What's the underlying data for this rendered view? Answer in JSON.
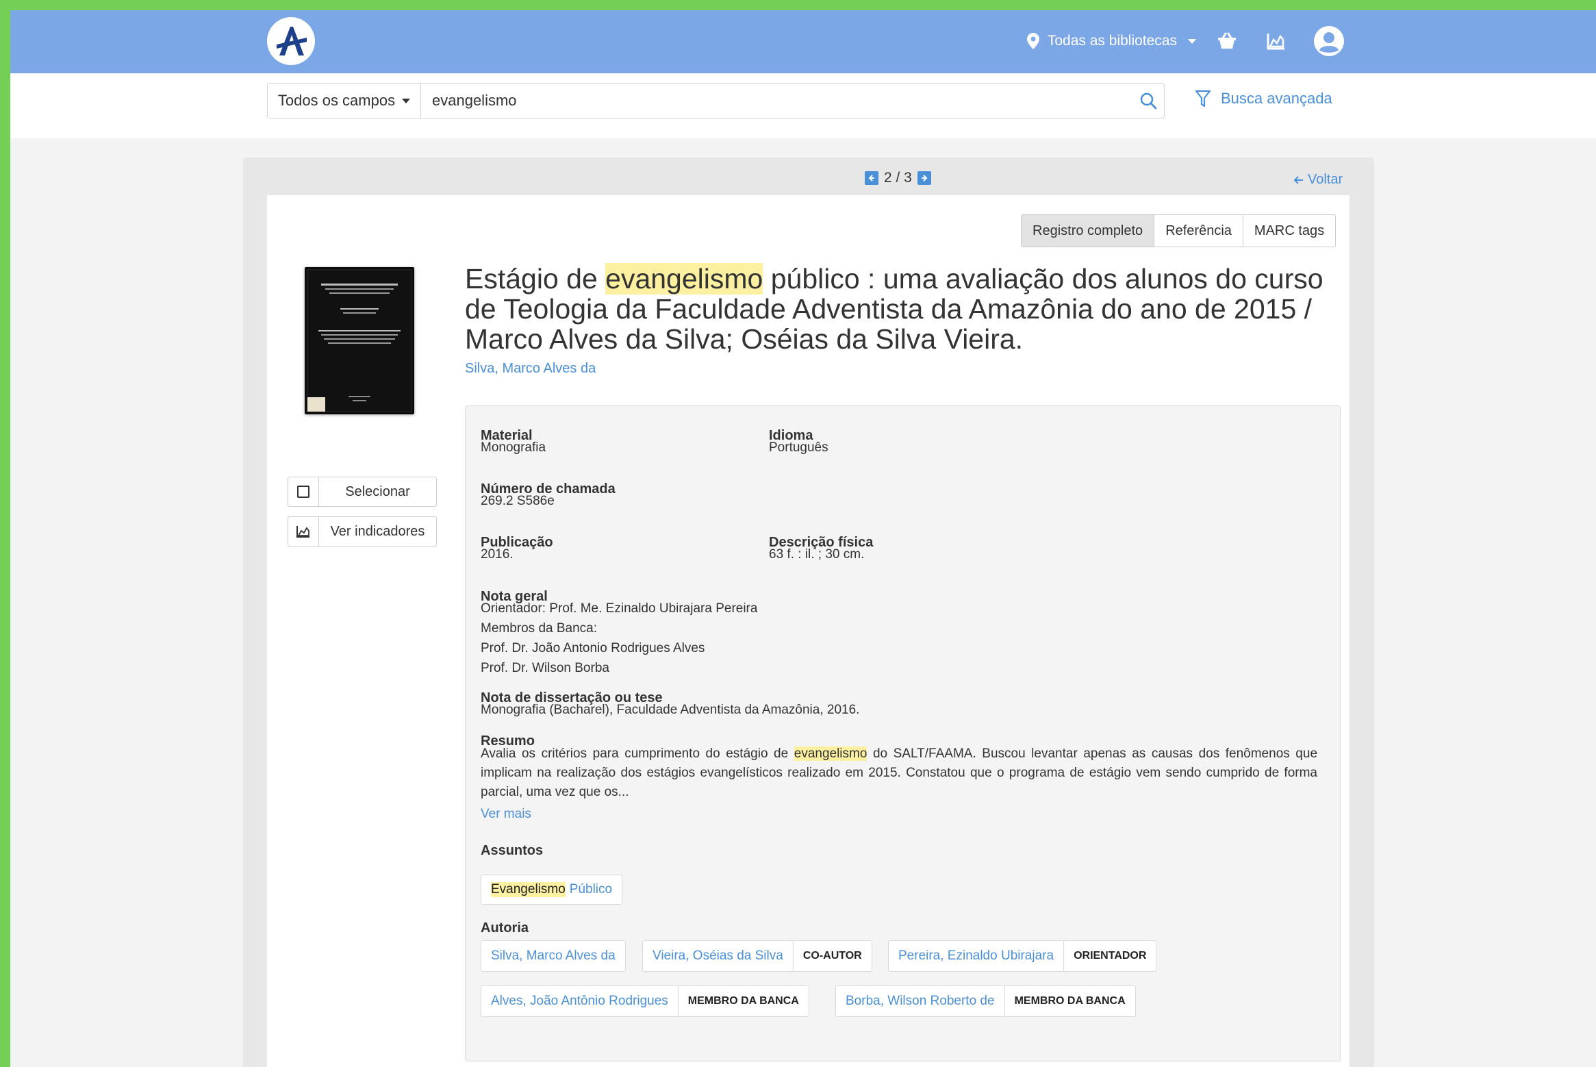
{
  "header": {
    "logo_alt": "A",
    "library_select": "Todas as bibliotecas"
  },
  "search": {
    "field_select": "Todos os campos",
    "value": "evangelismo",
    "advanced": "Busca avançada"
  },
  "pager": {
    "current": 2,
    "total": 3,
    "text": "2 / 3"
  },
  "back": "Voltar",
  "tabs": [
    "Registro completo",
    "Referência",
    "MARC tags"
  ],
  "sidebar": {
    "select": "Selecionar",
    "indicators": "Ver indicadores"
  },
  "record": {
    "title_before": "Estágio de ",
    "title_highlight": "evangelismo",
    "title_after": " público : uma avaliação dos alunos do curso de Teologia da Faculdade Adventista da Amazônia do ano de 2015 / Marco Alves da Silva; Oséias da Silva Vieira.",
    "author_link": "Silva, Marco Alves da",
    "fields": {
      "material_label": "Material",
      "material": "Monografia",
      "idioma_label": "Idioma",
      "idioma": "Português",
      "chamada_label": "Número de chamada",
      "chamada": "269.2 S586e",
      "publicacao_label": "Publicação",
      "publicacao": "2016.",
      "descricao_label": "Descrição física",
      "descricao": "63 f. : il. ; 30 cm.",
      "nota_geral_label": "Nota geral",
      "nota_geral": [
        "Orientador: Prof. Me. Ezinaldo Ubirajara Pereira",
        "Membros da Banca:",
        "Prof. Dr. João Antonio Rodrigues Alves",
        "Prof. Dr. Wilson Borba"
      ],
      "nota_tese_label": "Nota de dissertação ou tese",
      "nota_tese": "Monografia (Bacharel), Faculdade Adventista da Amazônia, 2016.",
      "resumo_label": "Resumo",
      "resumo_before": "Avalia os critérios para cumprimento do estágio de ",
      "resumo_highlight": "evangelismo",
      "resumo_after": " do SALT/FAAMA. Buscou levantar apenas as causas dos fenômenos que implicam na realização dos estágios evangelísticos realizado em 2015. Constatou que o programa de estágio vem sendo cumprido de forma parcial, uma vez que os...",
      "ver_mais": "Ver mais",
      "assuntos_label": "Assuntos",
      "assunto_1": "Evangelismo",
      "assunto_2": "Público",
      "autoria_label": "Autoria"
    },
    "authors": [
      {
        "name": "Silva, Marco Alves da",
        "role": ""
      },
      {
        "name": "Vieira, Oséias da Silva",
        "role": "CO-AUTOR"
      },
      {
        "name": "Pereira, Ezinaldo Ubirajara",
        "role": "ORIENTADOR"
      },
      {
        "name": "Alves, João Antônio Rodrigues",
        "role": "MEMBRO DA BANCA"
      },
      {
        "name": "Borba, Wilson Roberto de",
        "role": "MEMBRO DA BANCA"
      }
    ]
  },
  "colors": {
    "topbar": "#7ca7e6",
    "link": "#4a90d9",
    "highlight": "#fdf1a1",
    "border": "#74cf55"
  }
}
